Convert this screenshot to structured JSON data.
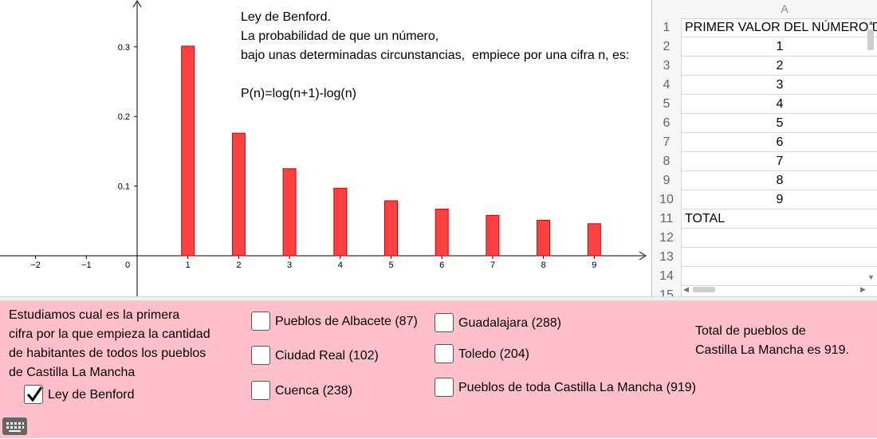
{
  "graphics": {
    "text_lines": [
      "Ley de Benford.",
      "La probabilidad de que un número,",
      "bajo unas determinadas circunstancias,  empiece por una cifra n, es:",
      "",
      "P(n)=log(n+1)-log(n)"
    ],
    "axis_ticks_x": [
      "−2",
      "−1",
      "0",
      "1",
      "2",
      "3",
      "4",
      "5",
      "6",
      "7",
      "8",
      "9"
    ],
    "axis_ticks_y": [
      "0.1",
      "0.2",
      "0.3"
    ],
    "bar_color": "#ff4040"
  },
  "chart_data": {
    "type": "bar",
    "categories": [
      1,
      2,
      3,
      4,
      5,
      6,
      7,
      8,
      9
    ],
    "values": [
      0.301,
      0.176,
      0.125,
      0.097,
      0.079,
      0.067,
      0.058,
      0.051,
      0.046
    ],
    "xlim": [
      -2.6,
      9.9
    ],
    "ylim": [
      0,
      0.36
    ],
    "grid": false
  },
  "spreadsheet": {
    "column_header": "A",
    "rows": [
      {
        "num": "1",
        "value": "PRIMER VALOR DEL NÚMERO D",
        "align": "left"
      },
      {
        "num": "2",
        "value": "1",
        "align": "center"
      },
      {
        "num": "3",
        "value": "2",
        "align": "center"
      },
      {
        "num": "4",
        "value": "3",
        "align": "center"
      },
      {
        "num": "5",
        "value": "4",
        "align": "center"
      },
      {
        "num": "6",
        "value": "5",
        "align": "center"
      },
      {
        "num": "7",
        "value": "6",
        "align": "center"
      },
      {
        "num": "8",
        "value": "7",
        "align": "center"
      },
      {
        "num": "9",
        "value": "8",
        "align": "center"
      },
      {
        "num": "10",
        "value": "9",
        "align": "center"
      },
      {
        "num": "11",
        "value": "TOTAL",
        "align": "left"
      },
      {
        "num": "12",
        "value": "",
        "align": "left"
      },
      {
        "num": "13",
        "value": "",
        "align": "left"
      },
      {
        "num": "14",
        "value": "",
        "align": "left"
      },
      {
        "num": "15",
        "value": "",
        "align": "left"
      }
    ]
  },
  "panel": {
    "description_lines": [
      "Estudiamos cual es la primera",
      "cifra por la que empieza la cantidad",
      "de habitantes de todos los pueblos",
      "de Castilla La Mancha"
    ],
    "total_lines": [
      "Total de pueblos de",
      "Castilla La Mancha es 919."
    ],
    "checkboxes": {
      "benford": {
        "label": "Ley de Benford",
        "checked": true
      },
      "albacete": {
        "label": "Pueblos de Albacete (87)",
        "checked": false
      },
      "ciudad_real": {
        "label": "Ciudad Real (102)",
        "checked": false
      },
      "cuenca": {
        "label": "Cuenca (238)",
        "checked": false
      },
      "guadalajara": {
        "label": "Guadalajara (288)",
        "checked": false
      },
      "toledo": {
        "label": "Toledo (204)",
        "checked": false
      },
      "toda": {
        "label": "Pueblos de toda Castilla La Mancha (919)",
        "checked": false
      }
    }
  },
  "background_color": "#ffc0cb"
}
